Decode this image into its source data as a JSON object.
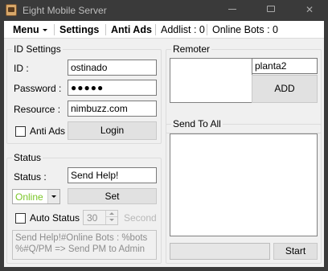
{
  "window": {
    "title": "Eight Mobile Server"
  },
  "menubar": {
    "menu": "Menu",
    "settings": "Settings",
    "anti_ads": "Anti Ads",
    "addlist": "Addlist : 0",
    "online_bots": "Online Bots : 0"
  },
  "id_settings": {
    "title": "ID Settings",
    "id_label": "ID :",
    "id_value": "ostinado",
    "password_label": "Password :",
    "password_value": "●●●●●",
    "resource_label": "Resource :",
    "resource_value": "nimbuzz.com",
    "anti_ads_label": "Anti Ads",
    "anti_ads_checked": false,
    "login_button": "Login"
  },
  "status": {
    "title": "Status",
    "status_label": "Status :",
    "status_value": "Send Help!",
    "presence_selected": "Online",
    "presence_color": "#7bc628",
    "set_button": "Set",
    "auto_status_label": "Auto Status",
    "auto_status_checked": false,
    "interval_value": "30",
    "interval_unit": "Second",
    "template_text": "Send Help!#Online Bots : %bots\n%#Q/PM => Send PM to Admin"
  },
  "remoter": {
    "title": "Remoter",
    "input_value": "planta2",
    "add_button": "ADD"
  },
  "send_to_all": {
    "title": "Send To All",
    "progress": 0,
    "start_button": "Start"
  }
}
